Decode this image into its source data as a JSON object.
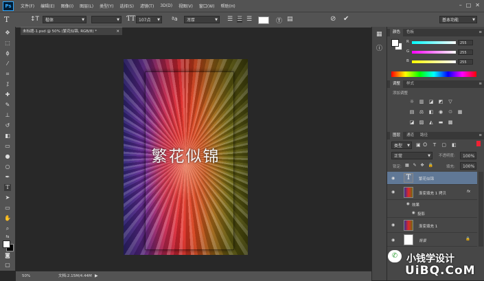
{
  "menu": {
    "logo": "Ps",
    "items": [
      "文件(F)",
      "编辑(E)",
      "图像(I)",
      "图层(L)",
      "类型(Y)",
      "选择(S)",
      "滤镜(T)",
      "3D(D)",
      "视图(V)",
      "窗口(W)",
      "帮助(H)"
    ]
  },
  "options": {
    "font_family": "楷体",
    "font_size": "107点",
    "antialias": "浑厚",
    "workspace": "基本功能"
  },
  "document": {
    "tab_title": "未标题-1.psd @ 50% (繁花似锦, RGB/8) *",
    "canvas_text": "繁花似锦"
  },
  "status": {
    "zoom": "50%",
    "doc_size": "文档:2.15M/4.44M"
  },
  "color_panel": {
    "tabs": [
      "颜色",
      "色板"
    ],
    "r_label": "R",
    "g_label": "G",
    "b_label": "B",
    "r_value": "255",
    "g_value": "255",
    "b_value": "255"
  },
  "adjust_panel": {
    "tabs": [
      "调整",
      "样式"
    ],
    "add_label": "添加调整"
  },
  "layers_panel": {
    "tabs": [
      "图层",
      "通道",
      "路径"
    ],
    "kind": "类型",
    "blend_mode": "正常",
    "opacity_label": "不透明度:",
    "opacity_value": "100%",
    "lock_label": "锁定:",
    "fill_label": "填充:",
    "fill_value": "100%",
    "layers": [
      {
        "name": "繁花似锦"
      },
      {
        "name": "渐变填充 1 拷贝"
      },
      {
        "name": "效果"
      },
      {
        "name": "投影"
      },
      {
        "name": "渐变填充 1"
      },
      {
        "name": "背景"
      }
    ]
  },
  "watermarks": {
    "wechat": "小钱学设计",
    "site": "UiBQ.CoM"
  }
}
